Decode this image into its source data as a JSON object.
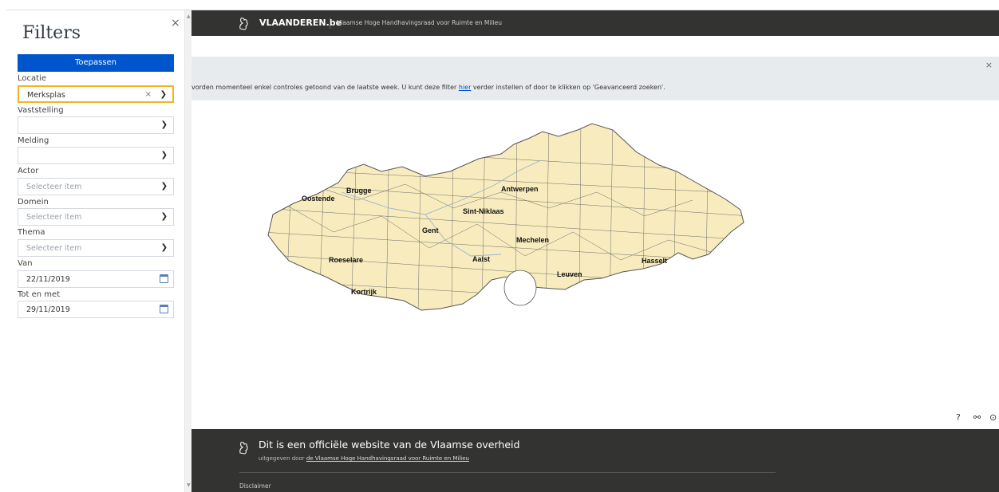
{
  "sidebar": {
    "title": "Filters",
    "close": "×",
    "apply_label": "Toepassen",
    "filters": [
      {
        "label": "Locatie",
        "value": "Merksplas",
        "placeholder": ""
      },
      {
        "label": "Vaststelling",
        "value": "",
        "placeholder": ""
      },
      {
        "label": "Melding",
        "value": "",
        "placeholder": ""
      },
      {
        "label": "Actor",
        "value": "",
        "placeholder": "Selecteer item"
      },
      {
        "label": "Domein",
        "value": "",
        "placeholder": "Selecteer item"
      },
      {
        "label": "Thema",
        "value": "",
        "placeholder": "Selecteer item"
      },
      {
        "label": "Van",
        "value": "22/11/2019",
        "placeholder": ""
      },
      {
        "label": "Tot en met",
        "value": "29/11/2019",
        "placeholder": ""
      }
    ],
    "clear": "×"
  },
  "header": {
    "brand": "VLAANDEREN.be",
    "org": "Vlaamse Hoge Handhavingsraad voor Ruimte en Milieu"
  },
  "notice": {
    "text_before": "vorden momenteel enkel controles getoond van de laatste week. U kunt deze filter ",
    "link": "hier",
    "text_after": " verder instellen of door te klikken op 'Geavanceerd zoeken'.",
    "close": "×"
  },
  "map": {
    "cities": [
      "Oostende",
      "Brugge",
      "Antwerpen",
      "Sint-Niklaas",
      "Gent",
      "Mechelen",
      "Roeselare",
      "Aalst",
      "Hasselt",
      "Leuven",
      "Kortrijk"
    ],
    "fill_color": "#f8ecbe",
    "controls": {
      "help": "?",
      "share": "⚯",
      "locate": "⊙"
    }
  },
  "footer": {
    "title": "Dit is een officiële website van de Vlaamse overheid",
    "sub_prefix": "uitgegeven door ",
    "sub_link": "de Vlaamse Hoge Handhavingsraad voor Ruimte en Milieu",
    "disclaimer": "Disclaimer"
  },
  "colors": {
    "primary": "#0055cc",
    "focus": "#f5b325",
    "dark": "#333332"
  }
}
